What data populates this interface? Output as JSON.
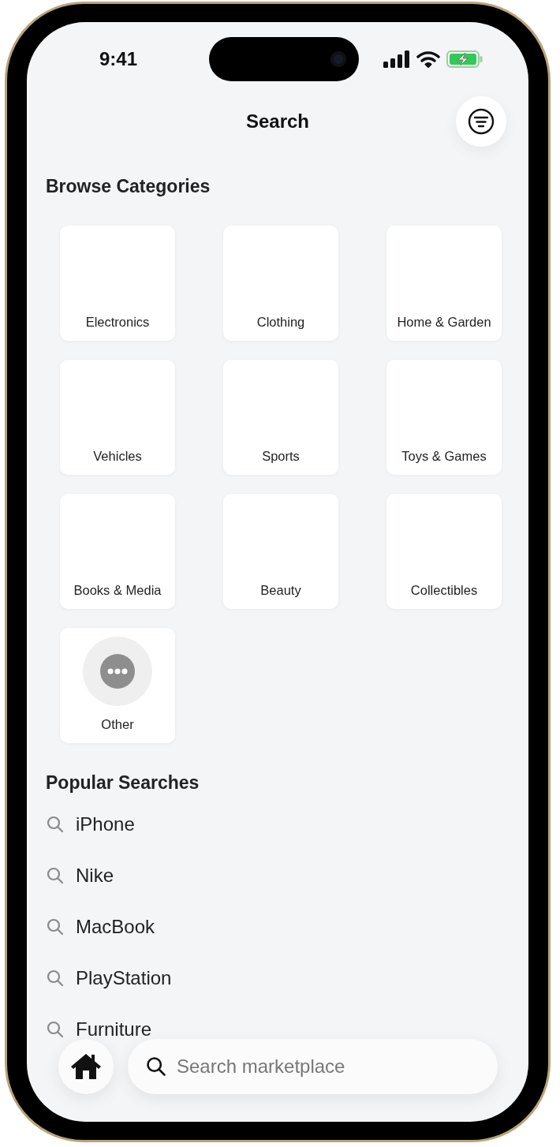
{
  "status_bar": {
    "time": "9:41"
  },
  "header": {
    "title": "Search"
  },
  "categories": {
    "heading": "Browse Categories",
    "items": [
      {
        "label": "Electronics",
        "kind": "plain"
      },
      {
        "label": "Clothing",
        "kind": "plain"
      },
      {
        "label": "Home & Garden",
        "kind": "plain"
      },
      {
        "label": "Vehicles",
        "kind": "plain"
      },
      {
        "label": "Sports",
        "kind": "plain"
      },
      {
        "label": "Toys & Games",
        "kind": "plain"
      },
      {
        "label": "Books & Media",
        "kind": "plain"
      },
      {
        "label": "Beauty",
        "kind": "plain"
      },
      {
        "label": "Collectibles",
        "kind": "plain"
      },
      {
        "label": "Other",
        "kind": "more"
      }
    ]
  },
  "popular": {
    "heading": "Popular Searches",
    "items": [
      "iPhone",
      "Nike",
      "MacBook",
      "PlayStation",
      "Furniture"
    ]
  },
  "bottom_bar": {
    "search": {
      "placeholder": "Search marketplace"
    }
  }
}
